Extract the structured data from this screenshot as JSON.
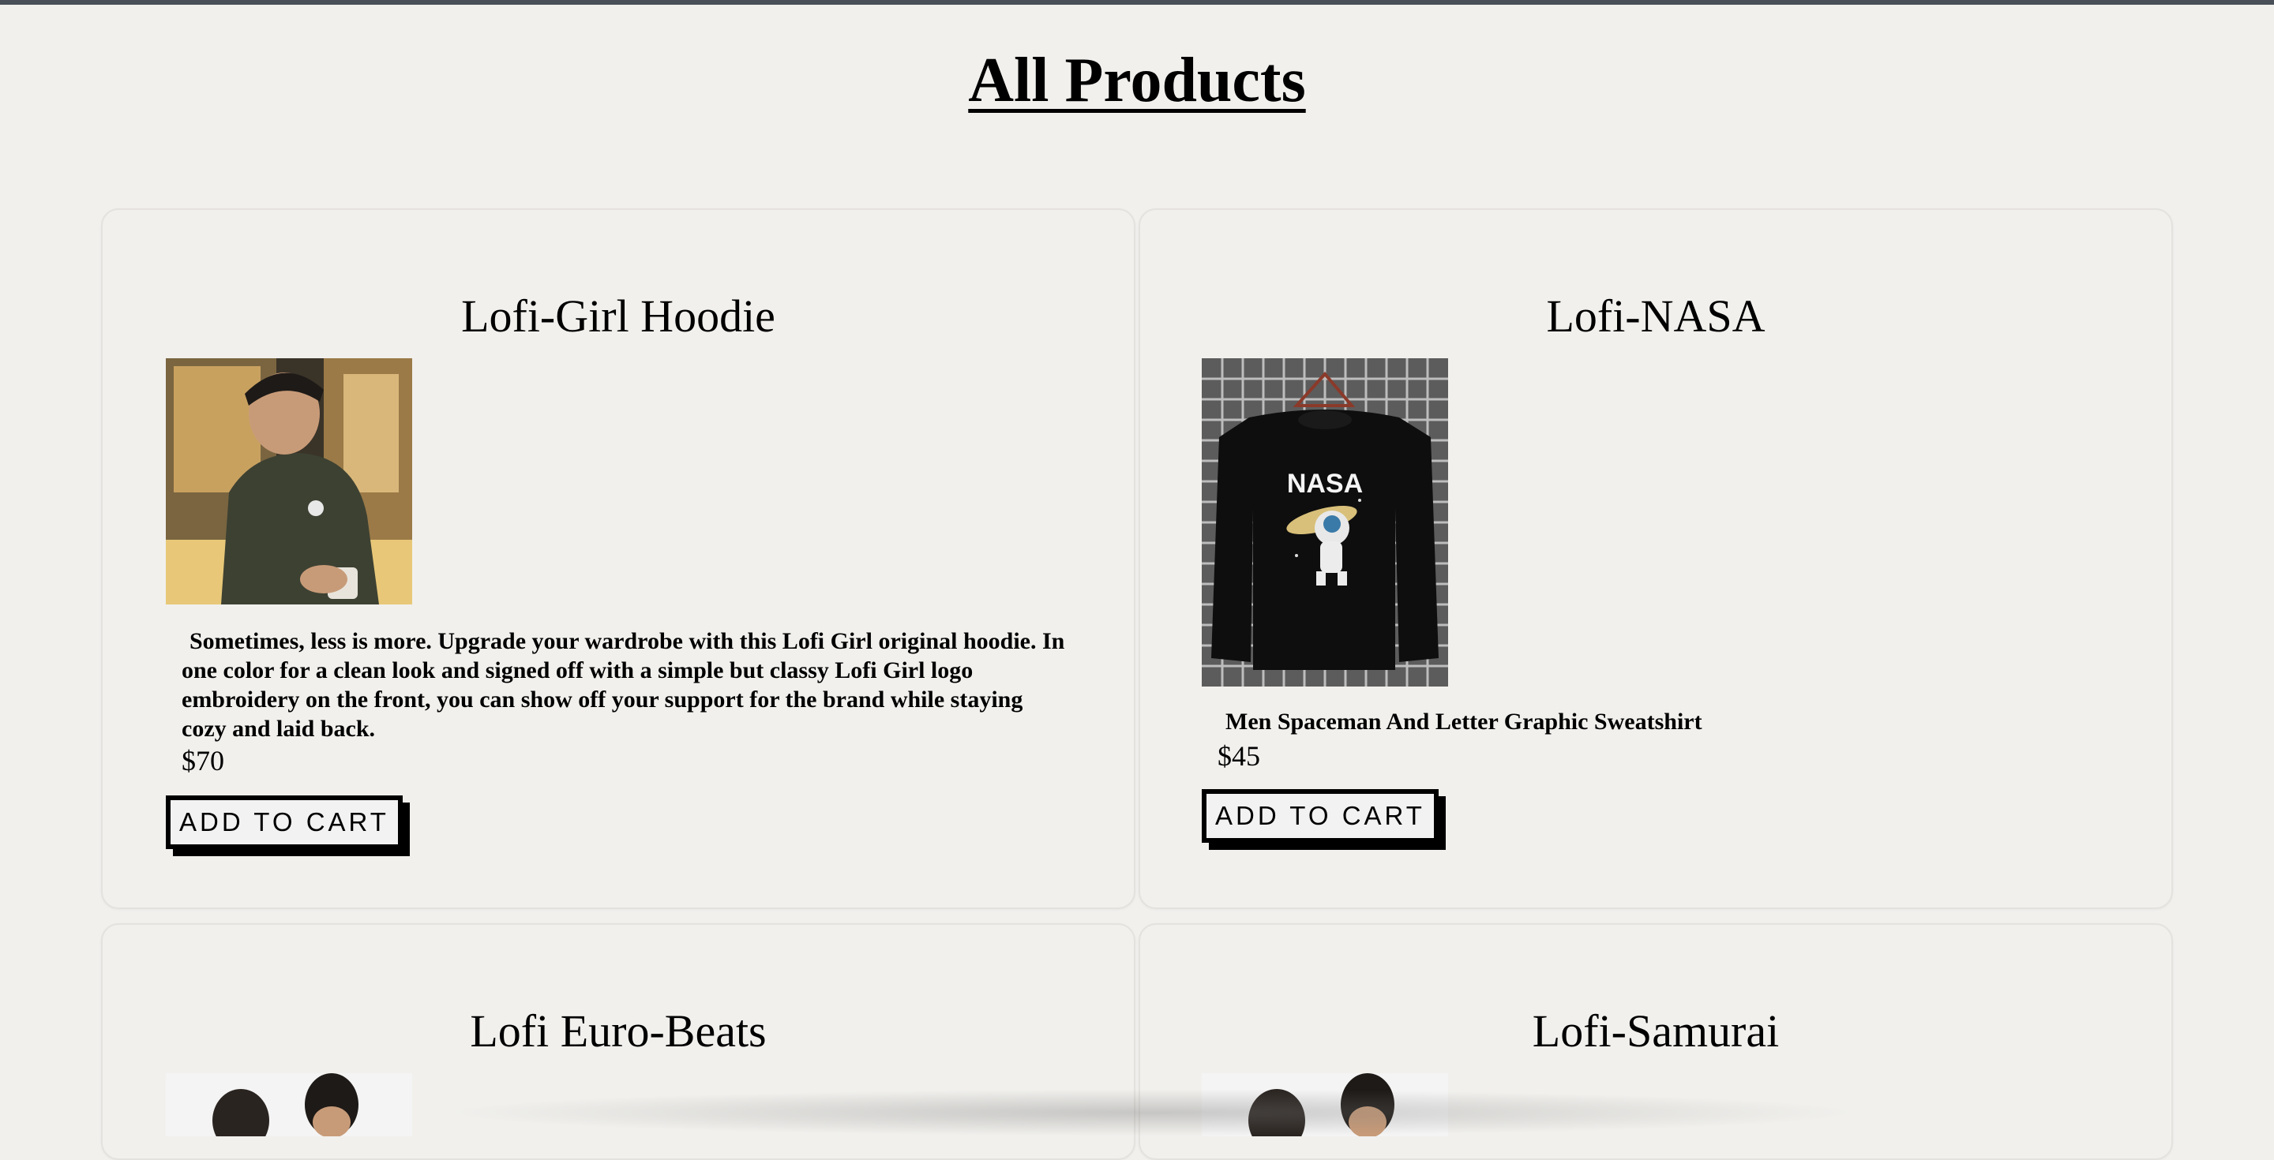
{
  "page": {
    "title": "All Products"
  },
  "products": [
    {
      "name": "Lofi-Girl Hoodie",
      "image": "man-in-olive-hoodie-holding-mug",
      "description": "Sometimes, less is more. Upgrade your wardrobe with this Lofi Girl original hoodie. In one color for a clean look and signed off with a simple but classy Lofi Girl logo embroidery on the front, you can show off your support for the brand while staying cozy and laid back.",
      "price": "$70",
      "button_label": "ADD TO CART"
    },
    {
      "name": "Lofi-NASA",
      "image": "black-nasa-spaceman-sweatshirt-on-hanger",
      "description": "Men Spaceman And Letter Graphic Sweatshirt",
      "price": "$45",
      "button_label": "ADD TO CART",
      "print_text": "NASA"
    },
    {
      "name": "Lofi Euro-Beats",
      "image": "two-people-photo"
    },
    {
      "name": "Lofi-Samurai",
      "image": "two-people-photo"
    }
  ],
  "colors": {
    "background": "#f1f0ed",
    "card_border": "#e4e2de",
    "button_bg": "#f2f2f2",
    "button_border": "#000000",
    "top_bar": "#4a5057"
  }
}
